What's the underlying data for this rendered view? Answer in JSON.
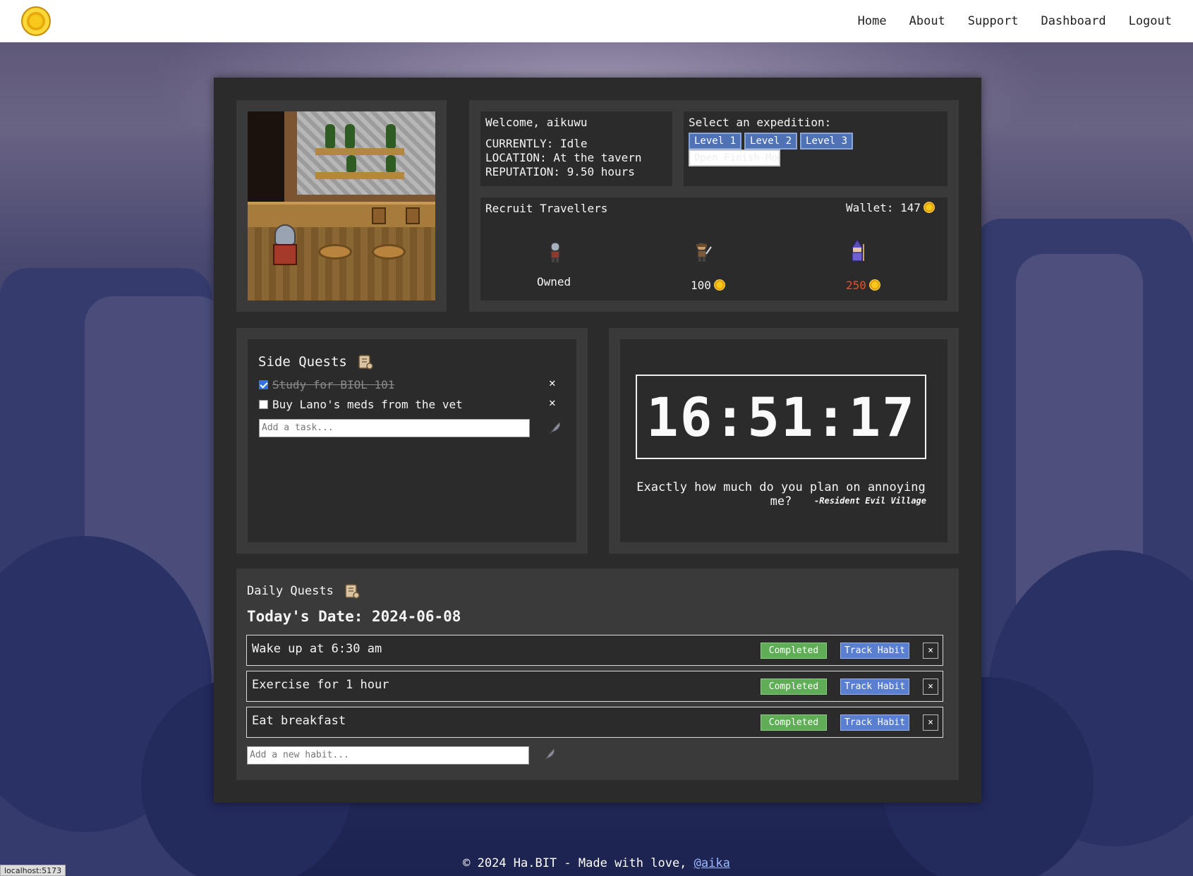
{
  "nav": {
    "logo_icon": "gold-coin-icon",
    "links": [
      "Home",
      "About",
      "Support",
      "Dashboard",
      "Logout"
    ]
  },
  "status": {
    "welcome": "Welcome, aikuwu",
    "currently": "CURRENTLY: Idle",
    "location": "LOCATION: At the tavern",
    "reputation": "REPUTATION: 9.50 hours"
  },
  "expedition": {
    "title": "Select an expedition:",
    "levels": [
      "Level 1",
      "Level 2",
      "Level 3"
    ],
    "modal_button": "Open Finish Modal"
  },
  "recruit": {
    "title": "Recruit Travellers",
    "wallet": "Wallet: 147",
    "travellers": [
      {
        "icon": "knight-sprite-icon",
        "status": "Owned"
      },
      {
        "icon": "ranger-sprite-icon",
        "price": "100",
        "price_color": "#ffffff"
      },
      {
        "icon": "wizard-sprite-icon",
        "price": "250",
        "price_color": "#e8502c"
      }
    ]
  },
  "side_quests": {
    "title": "Side Quests",
    "title_icon": "scroll-icon",
    "tasks": [
      {
        "label": "Study for BIOL 101",
        "done": true
      },
      {
        "label": "Buy Lano's meds from the vet",
        "done": false
      }
    ],
    "placeholder": "Add a task...",
    "add_icon": "quill-icon"
  },
  "clock": {
    "time": "16:51:17",
    "quote": "Exactly how much do you plan on annoying me?",
    "source": "-Resident Evil Village"
  },
  "daily_quests": {
    "title": "Daily Quests",
    "title_icon": "scroll-icon",
    "date": "Today's Date: 2024-06-08",
    "habits": [
      {
        "label": "Wake up at 6:30 am",
        "completed": "Completed",
        "track": "Track Habit",
        "remove": "×"
      },
      {
        "label": "Exercise for 1 hour",
        "completed": "Completed",
        "track": "Track Habit",
        "remove": "×"
      },
      {
        "label": "Eat breakfast",
        "completed": "Completed",
        "track": "Track Habit",
        "remove": "×"
      }
    ],
    "placeholder": "Add a new habit..."
  },
  "footer": {
    "text": "© 2024 Ha.BIT - Made with love, ",
    "link": "@aika"
  },
  "status_bar": {
    "url": "localhost:5173"
  },
  "colors": {
    "panel": "#2b2b2b",
    "card": "#3a3a3a",
    "completed_green": "#5fad56",
    "track_blue": "#5a7fd0",
    "level_blue": "#4f72b5"
  }
}
